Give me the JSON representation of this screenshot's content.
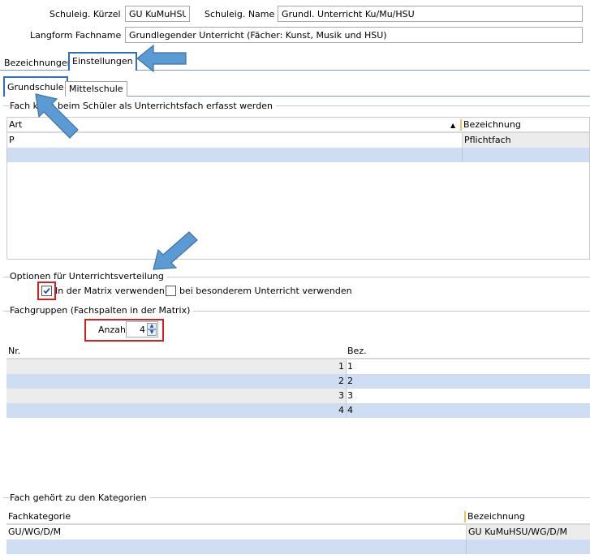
{
  "header": {
    "kuerzel_label": "Schuleig. Kürzel",
    "kuerzel_value": "GU KuMuHSU",
    "name_label": "Schuleig. Name",
    "name_value": "Grundl. Unterricht Ku/Mu/HSU",
    "langform_label": "Langform Fachname",
    "langform_value": "Grundlegender Unterricht (Fächer: Kunst, Musik und HSU)"
  },
  "tabs": [
    "Bezeichnungen",
    "Einstellungen"
  ],
  "subtabs": [
    "Grundschule",
    "Mittelschule"
  ],
  "unterrichtsfach": {
    "title": "Fach kann beim Schüler als Unterrichtsfach erfasst werden",
    "col_art": "Art",
    "col_bez": "Bezeichnung",
    "rows": [
      {
        "art": "P",
        "bez": "Pflichtfach"
      },
      {
        "art": "",
        "bez": ""
      }
    ]
  },
  "optionen": {
    "title": "Optionen für Unterrichtsverteilung",
    "matrix_label": "In der Matrix verwenden",
    "matrix_checked": true,
    "besonderer_label": "bei besonderem Unterricht verwenden",
    "besonderer_checked": false
  },
  "fachgruppen": {
    "title": "Fachgruppen (Fachspalten in der Matrix)",
    "anzahl_label": "Anzahl",
    "anzahl_value": "4",
    "col_nr": "Nr.",
    "col_bez": "Bez.",
    "rows": [
      {
        "nr": "1",
        "bez": "1"
      },
      {
        "nr": "2",
        "bez": "2"
      },
      {
        "nr": "3",
        "bez": "3"
      },
      {
        "nr": "4",
        "bez": "4"
      }
    ]
  },
  "kategorien": {
    "title": "Fach gehört zu den Kategorien",
    "col_kat": "Fachkategorie",
    "col_bez": "Bezeichnung",
    "rows": [
      {
        "kat": "GU/WG/D/M",
        "bez": "GU KuMuHSU/WG/D/M"
      },
      {
        "kat": "",
        "bez": ""
      }
    ]
  },
  "colors": {
    "selection": "#cfddf3",
    "annotation_red": "#d81e1e",
    "annotation_arrow": "#5b9bd5",
    "tab_highlight": "#2f6fc0"
  }
}
